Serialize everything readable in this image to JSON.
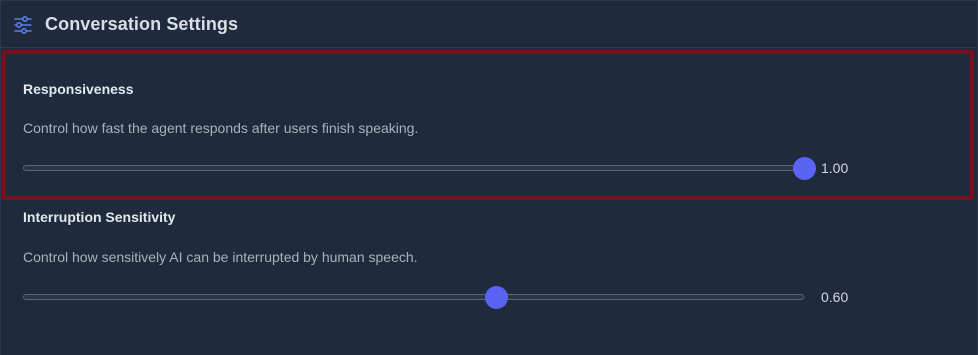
{
  "header": {
    "icon": "sliders-icon",
    "title": "Conversation Settings"
  },
  "settings": [
    {
      "title": "Responsiveness",
      "description": "Control how fast the agent responds after users finish speaking.",
      "value_label": "1.00",
      "value": 1.0,
      "min": 0,
      "max": 1,
      "highlighted": true
    },
    {
      "title": "Interruption Sensitivity",
      "description": "Control how sensitively AI can be interrupted by human speech.",
      "value_label": "0.60",
      "value": 0.6,
      "min": 0,
      "max": 1,
      "highlighted": false
    }
  ],
  "colors": {
    "background": "#1f2a3c",
    "accent": "#5b63f5",
    "highlight_border": "#7a0f1e"
  }
}
